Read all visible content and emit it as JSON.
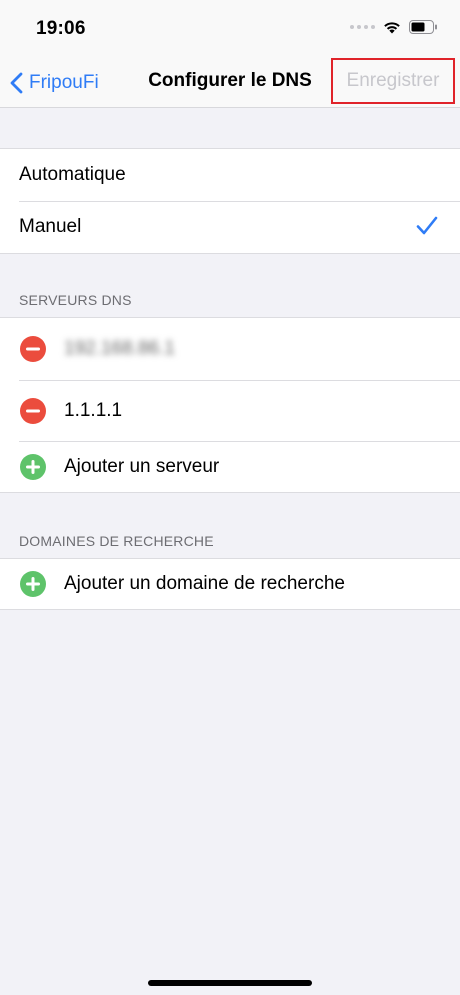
{
  "status_bar": {
    "time": "19:06"
  },
  "nav": {
    "back_label": "FripouFi",
    "title": "Configurer le DNS",
    "save_label": "Enregistrer"
  },
  "mode": {
    "options": [
      {
        "label": "Automatique",
        "selected": false
      },
      {
        "label": "Manuel",
        "selected": true
      }
    ]
  },
  "dns_servers": {
    "header": "SERVEURS DNS",
    "servers": [
      "192.168.86.1",
      "1.1.1.1"
    ],
    "add_label": "Ajouter un serveur"
  },
  "search_domains": {
    "header": "DOMAINES DE RECHERCHE",
    "add_label": "Ajouter un domaine de recherche"
  },
  "colors": {
    "accent": "#2f7cf6",
    "delete": "#eb4c3d",
    "add": "#5ec36a",
    "highlight": "#e0232a"
  }
}
